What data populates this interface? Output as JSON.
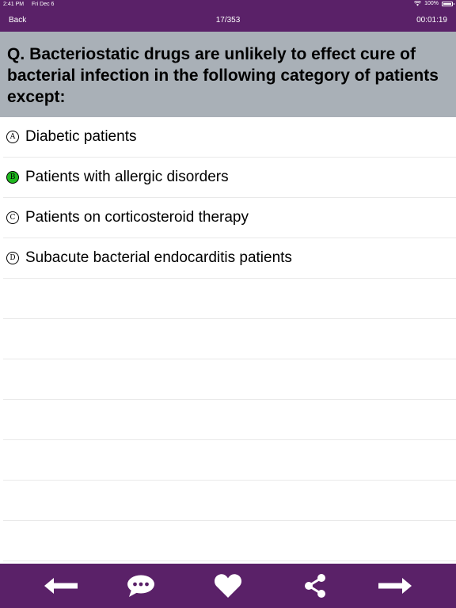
{
  "status_bar": {
    "time": "2:41 PM",
    "date": "Fri Dec 6",
    "battery": "100%",
    "icons": [
      "wifi-icon",
      "battery-icon"
    ]
  },
  "nav": {
    "back_label": "Back",
    "counter": "17/353",
    "timer": "00:01:19"
  },
  "question": {
    "prefix": "Q.",
    "text": "Bacteriostatic drugs are unlikely to effect cure of bacterial infection in the following category of patients except:"
  },
  "options": [
    {
      "letter": "A",
      "text": "Diabetic patients",
      "selected": false
    },
    {
      "letter": "B",
      "text": "Patients with allergic disorders",
      "selected": true
    },
    {
      "letter": "C",
      "text": "Patients on corticosteroid therapy",
      "selected": false
    },
    {
      "letter": "D",
      "text": "Subacute bacterial endocarditis patients",
      "selected": false
    }
  ],
  "toolbar": {
    "icons": [
      "arrow-left-icon",
      "comment-icon",
      "heart-icon",
      "share-icon",
      "arrow-right-icon"
    ]
  },
  "colors": {
    "primary": "#5a2168",
    "question_bg": "#a9b0b7",
    "selected_option": "#1fb81f",
    "divider": "#e9e9e9"
  }
}
